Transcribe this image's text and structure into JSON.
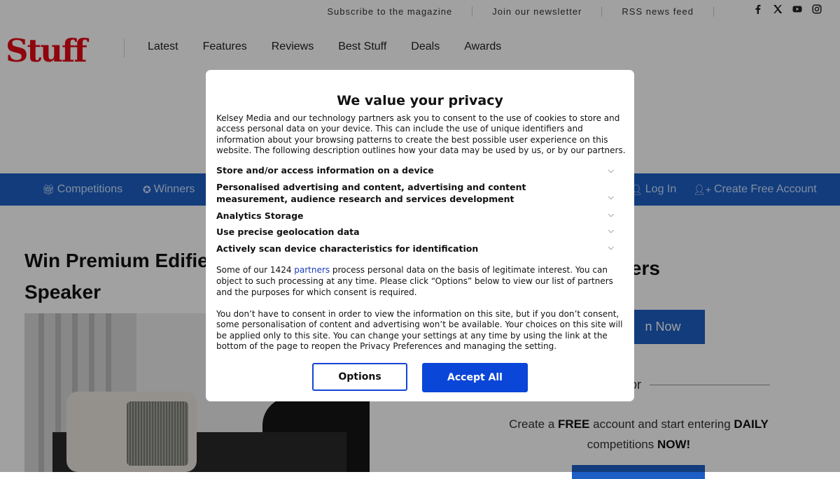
{
  "topbar": {
    "links": [
      "Subscribe to the magazine",
      "Join our newsletter",
      "RSS news feed"
    ],
    "social": [
      "facebook-icon",
      "x-icon",
      "youtube-icon",
      "instagram-icon"
    ]
  },
  "header": {
    "logo": "Stuff",
    "nav": [
      "Latest",
      "Features",
      "Reviews",
      "Best Stuff",
      "Deals",
      "Awards"
    ]
  },
  "bluenav": {
    "competitions": "Competitions",
    "winners": "Winners",
    "login": "Log In",
    "create_account": "Create Free Account"
  },
  "article": {
    "title_line1": "Win Premium Edifie",
    "title_line2": "Speaker"
  },
  "sidebar": {
    "members_title": "Members",
    "signin_label": "n Now",
    "or_label": "or",
    "promo_part1": "Create a ",
    "promo_free": "FREE",
    "promo_part2": " account and start entering ",
    "promo_daily": "DAILY",
    "promo_part3": "competitions ",
    "promo_now": "NOW!"
  },
  "modal": {
    "title": "We value your privacy",
    "intro": "Kelsey Media and our technology partners ask you to consent to the use of cookies to store and access personal data on your device. This can include the use of unique identifiers and information about your browsing patterns to create the best possible user experience on this website. The following description outlines how your data may be used by us, or by our partners.",
    "purposes": [
      "Store and/or access information on a device",
      "Personalised advertising and content, advertising and content measurement, audience research and services development",
      "Analytics Storage",
      "Use precise geolocation data",
      "Actively scan device characteristics for identification"
    ],
    "legit_part1": "Some of our 1424 ",
    "legit_link": "partners",
    "legit_part2": " process personal data on the basis of legitimate interest. You can object to such processing at any time. Please click “Options” below to view our list of partners and the purposes for which consent is required.",
    "consent_text": "You don’t have to consent in order to view the information on this site, but if you don’t consent, some personalisation of content and advertising won’t be available. Your choices on this site will be applied only to this site. You can change your settings at any time by using the link at the bottom of the page to reopen the Privacy Preferences and managing the setting.",
    "options_label": "Options",
    "accept_label": "Accept All"
  }
}
